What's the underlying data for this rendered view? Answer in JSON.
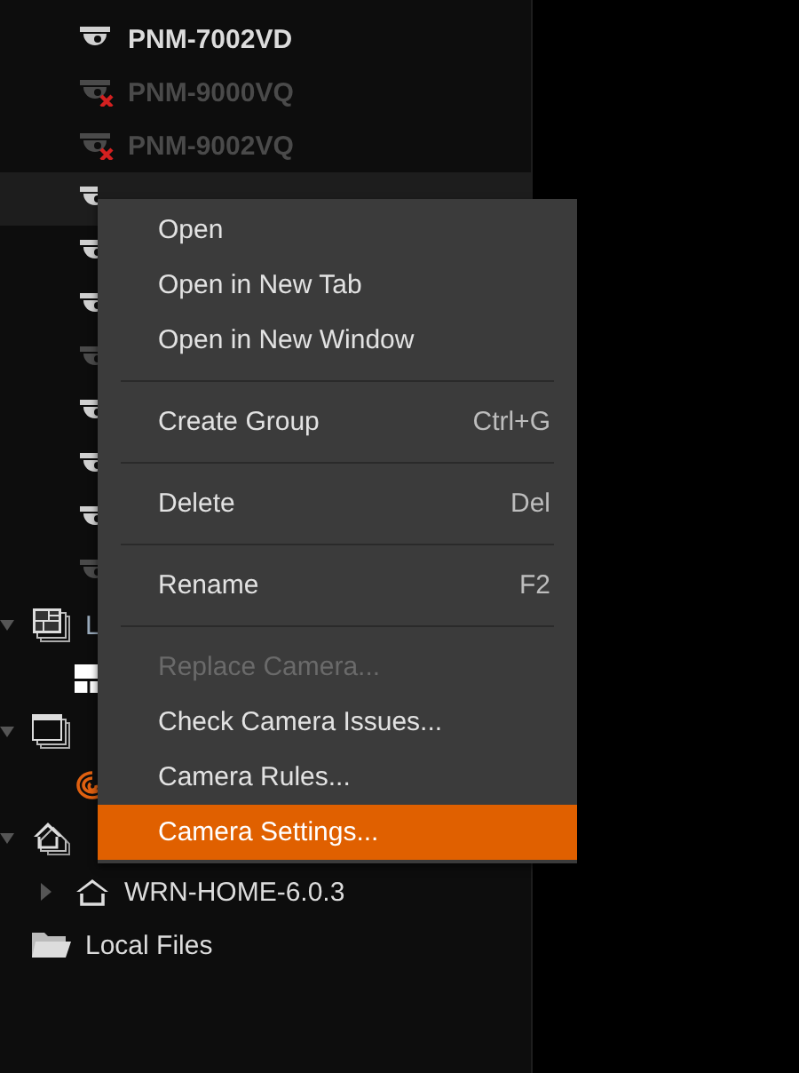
{
  "cameras": [
    {
      "label": "PNM-7002VD",
      "offline": false,
      "selected": false
    },
    {
      "label": "PNM-9000VQ",
      "offline": true,
      "selected": false
    },
    {
      "label": "PNM-9002VQ",
      "offline": true,
      "selected": false
    },
    {
      "offline": false,
      "selected": true
    },
    {
      "offline": false,
      "selected": false
    },
    {
      "offline": false,
      "selected": false
    },
    {
      "offline": true,
      "selected": false
    },
    {
      "offline": false,
      "selected": false
    },
    {
      "offline": false,
      "selected": false
    },
    {
      "offline": false,
      "selected": false
    },
    {
      "offline": true,
      "selected": false
    }
  ],
  "tree": [
    {
      "kind": "layouts",
      "label": "L",
      "expanded": true,
      "children": [
        {
          "kind": "layout"
        }
      ]
    },
    {
      "kind": "webpages",
      "expanded": true,
      "children": [
        {
          "kind": "webpage"
        }
      ]
    },
    {
      "kind": "servers",
      "expanded": true,
      "children": [
        {
          "kind": "server",
          "label": "WRN-HOME-6.0.3",
          "expanded": false
        }
      ]
    },
    {
      "kind": "folder",
      "label": "Local Files"
    }
  ],
  "context_menu": [
    {
      "kind": "item",
      "label": "Open",
      "disabled": false,
      "selected": false
    },
    {
      "kind": "item",
      "label": "Open in New Tab",
      "disabled": false,
      "selected": false
    },
    {
      "kind": "item",
      "label": "Open in New Window",
      "disabled": false,
      "selected": false
    },
    {
      "kind": "separator"
    },
    {
      "kind": "item",
      "label": "Create Group",
      "shortcut": "Ctrl+G",
      "disabled": false,
      "selected": false
    },
    {
      "kind": "separator"
    },
    {
      "kind": "item",
      "label": "Delete",
      "shortcut": "Del",
      "disabled": false,
      "selected": false
    },
    {
      "kind": "separator"
    },
    {
      "kind": "item",
      "label": "Rename",
      "shortcut": "F2",
      "disabled": false,
      "selected": false
    },
    {
      "kind": "separator"
    },
    {
      "kind": "item",
      "label": "Replace Camera...",
      "disabled": true,
      "selected": false
    },
    {
      "kind": "item",
      "label": "Check Camera Issues...",
      "disabled": false,
      "selected": false
    },
    {
      "kind": "item",
      "label": "Camera Rules...",
      "disabled": false,
      "selected": false
    },
    {
      "kind": "item",
      "label": "Camera Settings...",
      "disabled": false,
      "selected": true
    }
  ]
}
